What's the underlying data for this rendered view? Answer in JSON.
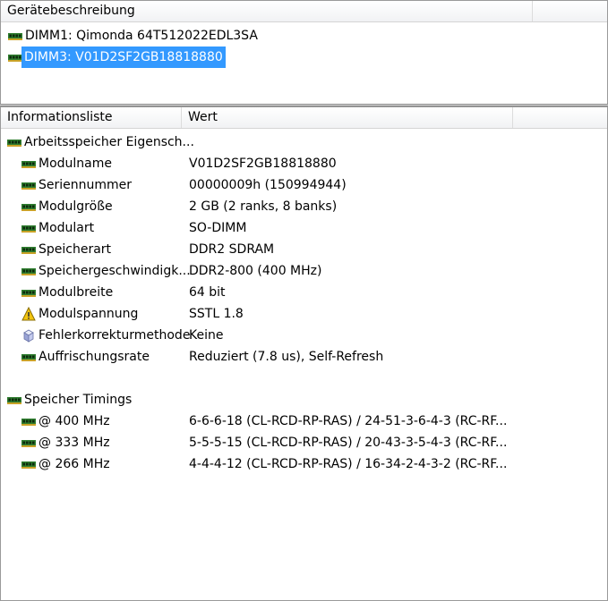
{
  "device_pane": {
    "header": "Gerätebeschreibung",
    "items": [
      {
        "label": "DIMM1: Qimonda 64T512022EDL3SA",
        "selected": false
      },
      {
        "label": "DIMM3: V01D2SF2GB18818880",
        "selected": true
      }
    ]
  },
  "info_pane": {
    "col_name": "Informationsliste",
    "col_value": "Wert",
    "groups": [
      {
        "label": "Arbeitsspeicher Eigensch...",
        "icon": "memory-icon",
        "rows": [
          {
            "name": "Modulname",
            "value": "V01D2SF2GB18818880",
            "icon": "memory-icon"
          },
          {
            "name": "Seriennummer",
            "value": "00000009h (150994944)",
            "icon": "memory-icon"
          },
          {
            "name": "Modulgröße",
            "value": "2 GB (2 ranks, 8 banks)",
            "icon": "memory-icon"
          },
          {
            "name": "Modulart",
            "value": "SO-DIMM",
            "icon": "memory-icon"
          },
          {
            "name": "Speicherart",
            "value": "DDR2 SDRAM",
            "icon": "memory-icon"
          },
          {
            "name": "Speichergeschwindigk...",
            "value": "DDR2-800 (400 MHz)",
            "icon": "memory-icon"
          },
          {
            "name": "Modulbreite",
            "value": "64 bit",
            "icon": "memory-icon"
          },
          {
            "name": "Modulspannung",
            "value": "SSTL 1.8",
            "icon": "voltage-warning-icon"
          },
          {
            "name": "Fehlerkorrekturmethode",
            "value": "Keine",
            "icon": "ecc-cube-icon"
          },
          {
            "name": "Auffrischungsrate",
            "value": "Reduziert (7.8 us), Self-Refresh",
            "icon": "memory-icon"
          }
        ]
      },
      {
        "label": "Speicher Timings",
        "icon": "memory-icon",
        "rows": [
          {
            "name": "@ 400 MHz",
            "value": "6-6-6-18  (CL-RCD-RP-RAS) / 24-51-3-6-4-3  (RC-RF...",
            "icon": "memory-icon"
          },
          {
            "name": "@ 333 MHz",
            "value": "5-5-5-15  (CL-RCD-RP-RAS) / 20-43-3-5-4-3  (RC-RF...",
            "icon": "memory-icon"
          },
          {
            "name": "@ 266 MHz",
            "value": "4-4-4-12  (CL-RCD-RP-RAS) / 16-34-2-4-3-2  (RC-RF...",
            "icon": "memory-icon"
          }
        ]
      }
    ]
  },
  "colors": {
    "selection": "#3399ff",
    "memory_icon": "#2e7d32"
  }
}
